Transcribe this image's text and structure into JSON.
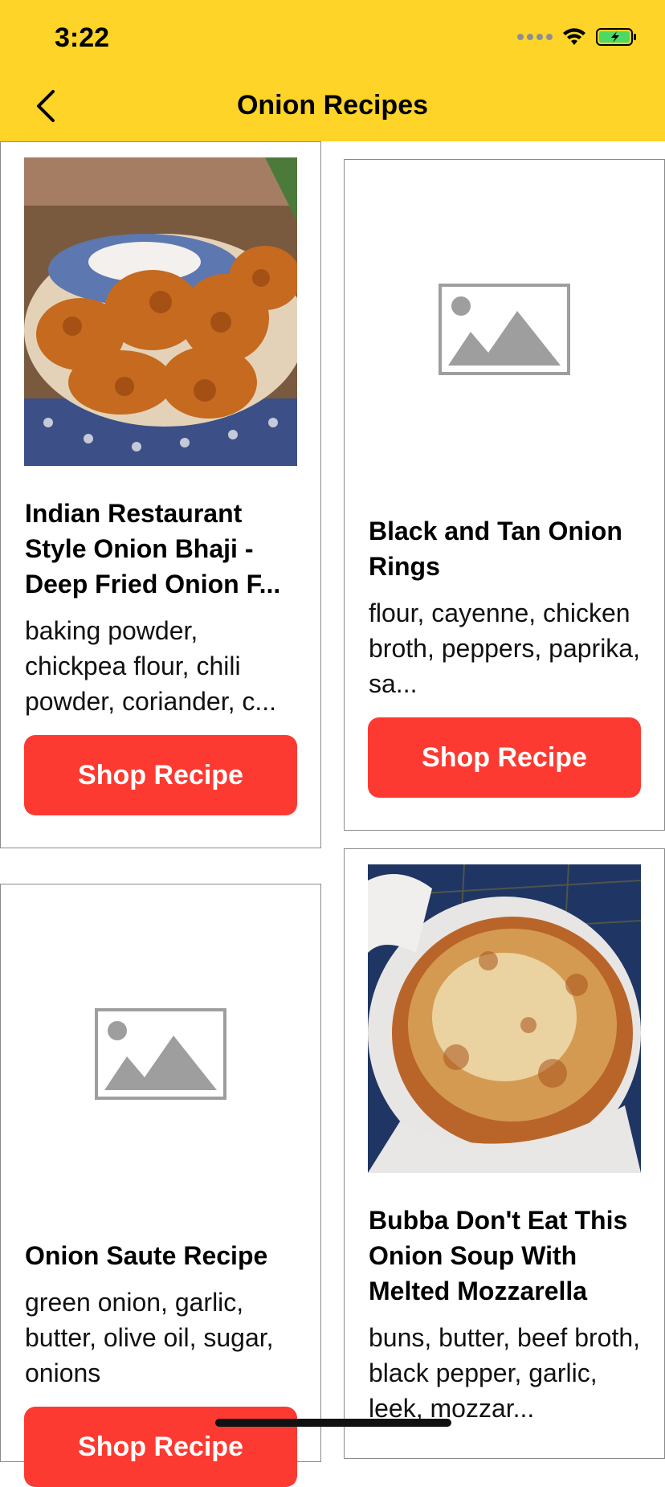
{
  "status": {
    "time": "3:22"
  },
  "nav": {
    "title": "Onion Recipes"
  },
  "recipes": [
    {
      "title": "Indian Restaurant Style Onion Bhaji - Deep Fried Onion F...",
      "ingredients": "baking powder, chickpea flour, chili powder, coriander, c...",
      "button": "Shop Recipe",
      "has_image": true
    },
    {
      "title": "Black and Tan Onion Rings",
      "ingredients": "flour, cayenne, chicken broth, peppers, paprika, sa...",
      "button": "Shop Recipe",
      "has_image": false
    },
    {
      "title": "Onion Saute Recipe",
      "ingredients": "green onion, garlic, butter, olive oil, sugar, onions",
      "button": "Shop Recipe",
      "has_image": false
    },
    {
      "title": "Bubba Don't Eat This Onion Soup With Melted Mozzarella",
      "ingredients": "buns, butter, beef broth, black pepper, garlic, leek, mozzar...",
      "button": "Shop Recipe",
      "has_image": true
    }
  ],
  "colors": {
    "header": "#fdd427",
    "button": "#fd3a31"
  }
}
